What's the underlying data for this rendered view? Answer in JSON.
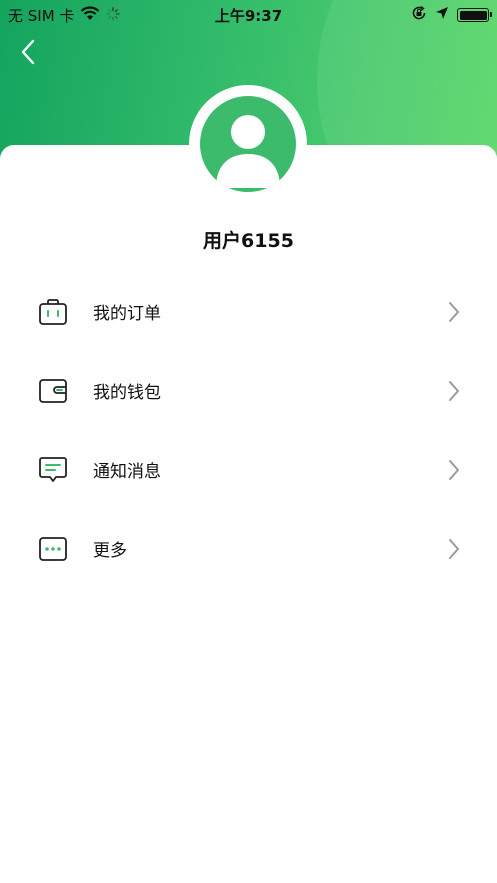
{
  "status_bar": {
    "carrier": "无 SIM 卡",
    "time": "上午9:37"
  },
  "profile": {
    "username": "用户6155"
  },
  "menu": {
    "items": [
      {
        "label": "我的订单",
        "icon": "bag-icon"
      },
      {
        "label": "我的钱包",
        "icon": "wallet-icon"
      },
      {
        "label": "通知消息",
        "icon": "message-icon"
      },
      {
        "label": "更多",
        "icon": "more-icon"
      }
    ]
  },
  "colors": {
    "accent": "#3dbb6c",
    "header_start": "#14a45e",
    "header_end": "#57d665"
  }
}
